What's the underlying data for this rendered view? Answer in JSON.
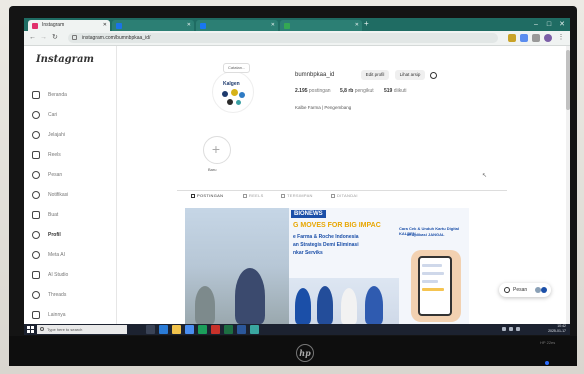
{
  "browser": {
    "tabs": [
      {
        "label": "Instagram",
        "favicon_color": "#e1306c"
      },
      {
        "label": "",
        "favicon_color": "#1a73e8"
      },
      {
        "label": "",
        "favicon_color": "#1877f2"
      },
      {
        "label": "",
        "favicon_color": "#34a853"
      }
    ],
    "new_tab": "+",
    "window_controls": [
      "–",
      "□",
      "✕"
    ],
    "nav_icons": [
      "arrow-left-icon",
      "arrow-right-icon",
      "reload-icon"
    ],
    "address": "instagram.com/bumnbpkaa_id/"
  },
  "sidebar": {
    "logo": "Instagram",
    "items": [
      {
        "label": "Beranda",
        "icon": "home-icon"
      },
      {
        "label": "Cari",
        "icon": "search-icon"
      },
      {
        "label": "Jelajahi",
        "icon": "compass-icon"
      },
      {
        "label": "Reels",
        "icon": "reels-icon"
      },
      {
        "label": "Pesan",
        "icon": "messenger-icon"
      },
      {
        "label": "Notifikasi",
        "icon": "heart-icon"
      },
      {
        "label": "Buat",
        "icon": "plus-square-icon"
      },
      {
        "label": "Profil",
        "icon": "profile-icon"
      },
      {
        "label": "Meta AI",
        "icon": "meta-ai-icon"
      },
      {
        "label": "AI Studio",
        "icon": "ai-studio-icon"
      },
      {
        "label": "Threads",
        "icon": "threads-icon"
      },
      {
        "label": "Lainnya",
        "icon": "menu-icon"
      }
    ]
  },
  "profile": {
    "note": "Catatan...",
    "avatar_wordmark": "Kalgen",
    "username": "bumnbpkaa_id",
    "edit_button": "Edit profil",
    "archive_button": "Lihat arsip",
    "stats": [
      {
        "value": "2.195",
        "label": "postingan"
      },
      {
        "value": "5,8 rb",
        "label": "pengikut"
      },
      {
        "value": "519",
        "label": "diikuti"
      }
    ],
    "bio": "Kalbe Farma | Pengembang",
    "highlight_label": "Baru"
  },
  "profile_tabs": [
    {
      "label": "POSTINGAN",
      "active": true
    },
    {
      "label": "REELS",
      "active": false
    },
    {
      "label": "TERSIMPAN",
      "active": false
    },
    {
      "label": "DITANDAI",
      "active": false
    }
  ],
  "post": {
    "tag": "BIONEWS",
    "headline": "G MOVES FOR BIG IMPAC",
    "lines": [
      "e Farma & Roche Indonesia",
      "an Strategis Demi Eliminasi",
      "nkar Serviks"
    ],
    "side_lines": [
      "Cara Cek & Unduh Kartu Digital KALBEN",
      "di Aplikasi JANGAL"
    ]
  },
  "messages_button": {
    "label": "Pesan"
  },
  "taskbar": {
    "search_placeholder": "Type here to search",
    "clock_time": "10:42",
    "clock_date": "2025-01-17"
  },
  "monitor": {
    "brand": "HP 22es"
  },
  "colors": {
    "tabbar": "#1f6c63",
    "accent_blue": "#1b4fa8",
    "accent_yellow": "#e8a600",
    "taskbar": "#1c2230"
  }
}
